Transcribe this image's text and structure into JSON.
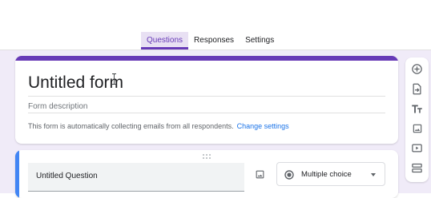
{
  "tabs": [
    {
      "label": "Questions",
      "active": true
    },
    {
      "label": "Responses",
      "active": false
    },
    {
      "label": "Settings",
      "active": false
    }
  ],
  "form": {
    "title": "Untitled form",
    "description_placeholder": "Form description",
    "email_notice": "This form is automatically collecting emails from all respondents.",
    "change_settings_link": "Change settings"
  },
  "question": {
    "title": "Untitled Question",
    "type_label": "Multiple choice",
    "type_icon": "radio-button-icon"
  },
  "toolbar": {
    "items": [
      {
        "icon": "add-question-icon"
      },
      {
        "icon": "import-questions-icon"
      },
      {
        "icon": "add-title-description-icon"
      },
      {
        "icon": "add-image-icon"
      },
      {
        "icon": "add-video-icon"
      },
      {
        "icon": "add-section-icon"
      }
    ]
  },
  "colors": {
    "accent": "#673ab7",
    "background": "#f0ebf8",
    "active_question": "#4285f4",
    "link": "#1a73e8"
  }
}
